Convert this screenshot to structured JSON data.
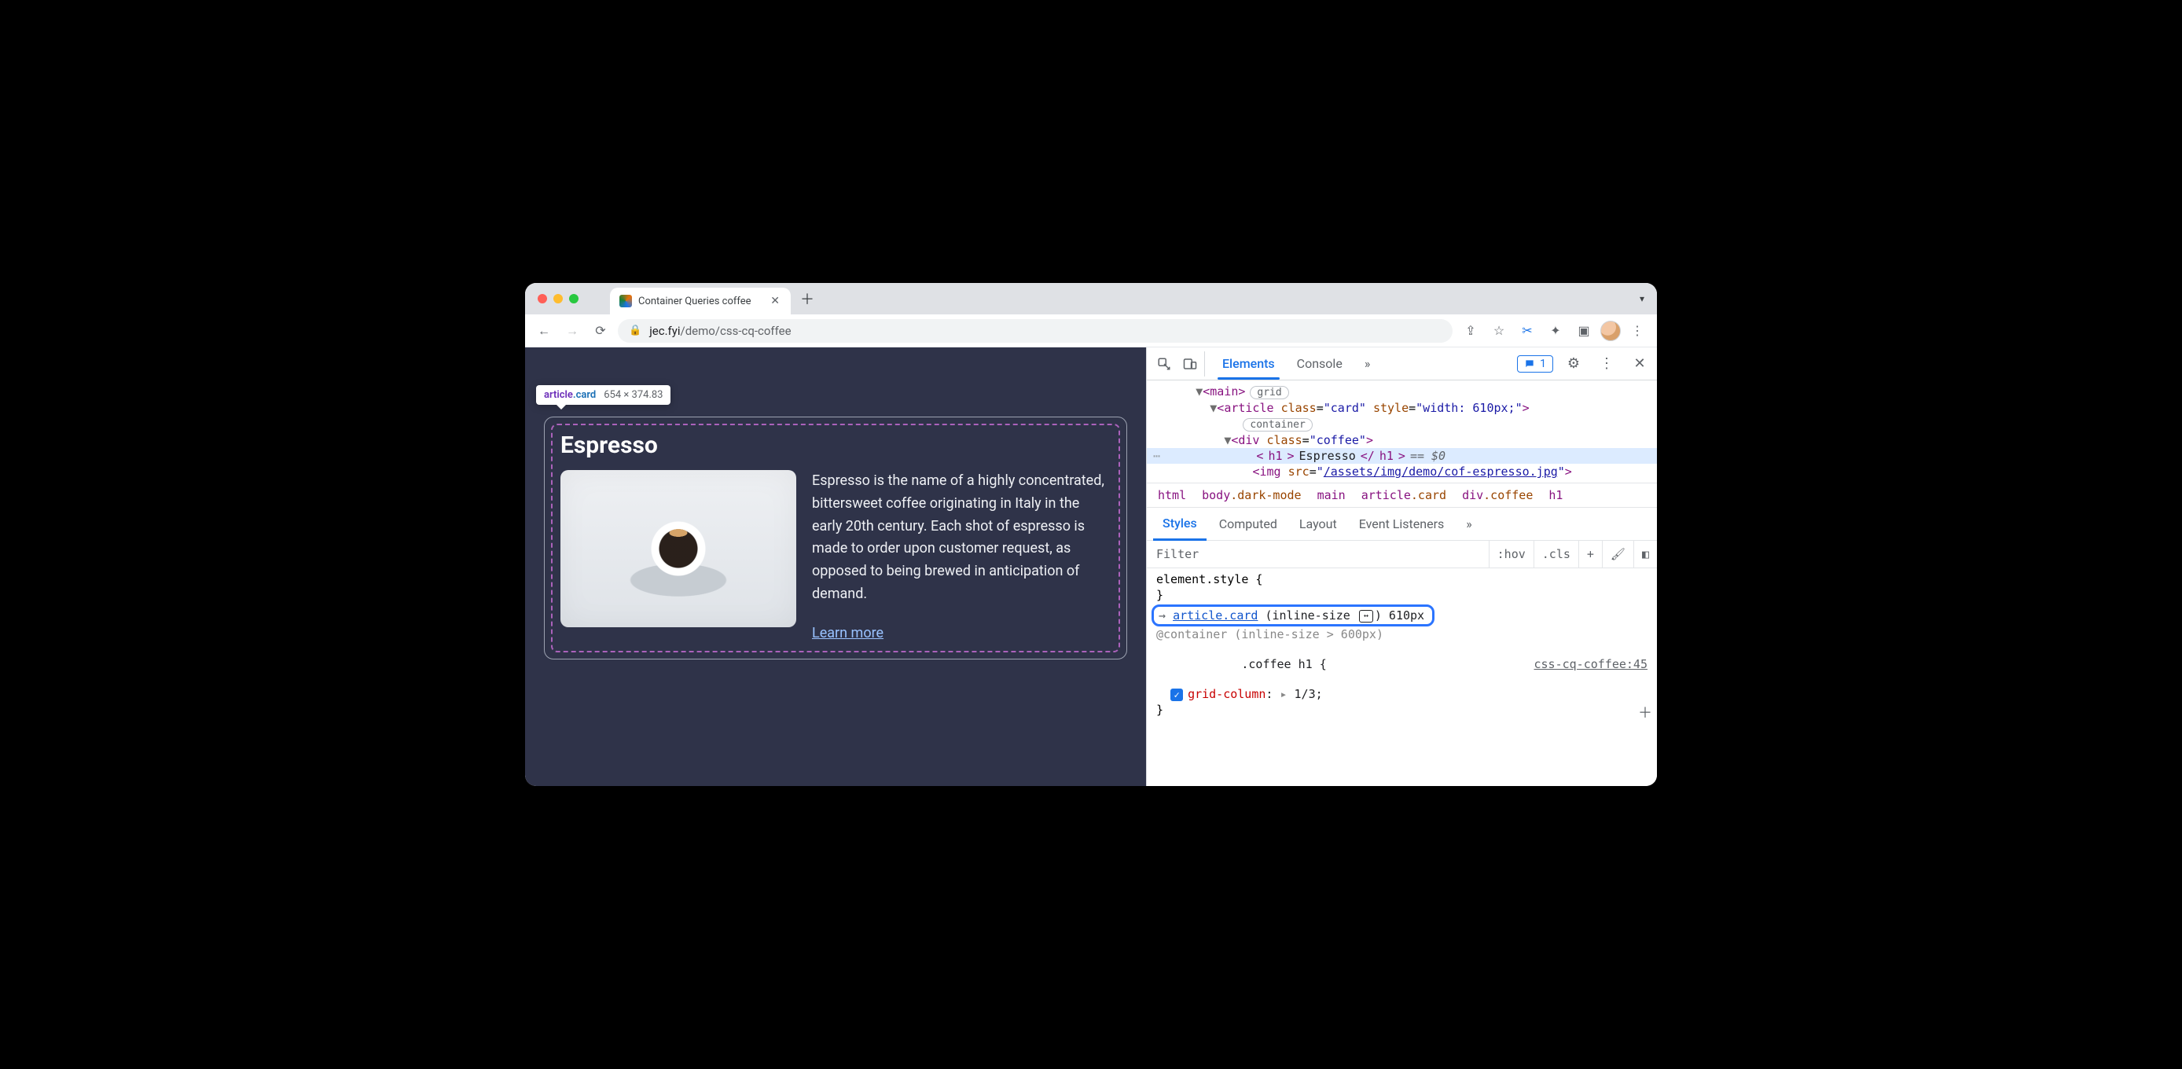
{
  "window": {
    "tab_title": "Container Queries coffee",
    "url_host": "jec.fyi",
    "url_path": "/demo/css-cq-coffee",
    "chevron_label": "▾"
  },
  "tooltip": {
    "selector_tag": "article",
    "selector_class": ".card",
    "dimensions": "654 × 374.83"
  },
  "page": {
    "title": "Espresso",
    "description": "Espresso is the name of a highly concentrated, bittersweet coffee originating in Italy in the early 20th century. Each shot of espresso is made to order upon customer request, as opposed to being brewed in anticipation of demand.",
    "learn_more": "Learn more"
  },
  "devtools": {
    "tabs": {
      "elements": "Elements",
      "console": "Console"
    },
    "overflow_glyph": "»",
    "issue_count": "1",
    "dom": {
      "main_open": "<main>",
      "main_badge": "grid",
      "article_open": "<article class=\"card\" style=\"width: 610px;\">",
      "article_badge": "container",
      "div_open": "<div class=\"coffee\">",
      "h1_line": "<h1>Espresso</h1>",
      "h1_eq": "== $0",
      "img_prefix": "<img src=\"",
      "img_src": "/assets/img/demo/cof-espresso.jpg",
      "img_suffix": "\">"
    },
    "crumb": [
      "html",
      "body.dark-mode",
      "main",
      "article.card",
      "div.coffee",
      "h1"
    ],
    "styles_tabs": {
      "styles": "Styles",
      "computed": "Computed",
      "layout": "Layout",
      "events": "Event Listeners"
    },
    "filter": {
      "placeholder": "Filter",
      "hov": ":hov",
      "cls": ".cls",
      "plus": "+"
    },
    "styles": {
      "element_style": "element.style {",
      "close": "}",
      "cq": {
        "arrow": "→",
        "selector": "article.card",
        "open_paren": "(inline-size",
        "close_text": ") 610px"
      },
      "container_line": "@container (inline-size > 600px)",
      "rule_selector": ".coffee h1 {",
      "src": "css-cq-coffee:45",
      "prop_name": "grid-column",
      "prop_play": "▸",
      "prop_value": "1/3;"
    }
  }
}
